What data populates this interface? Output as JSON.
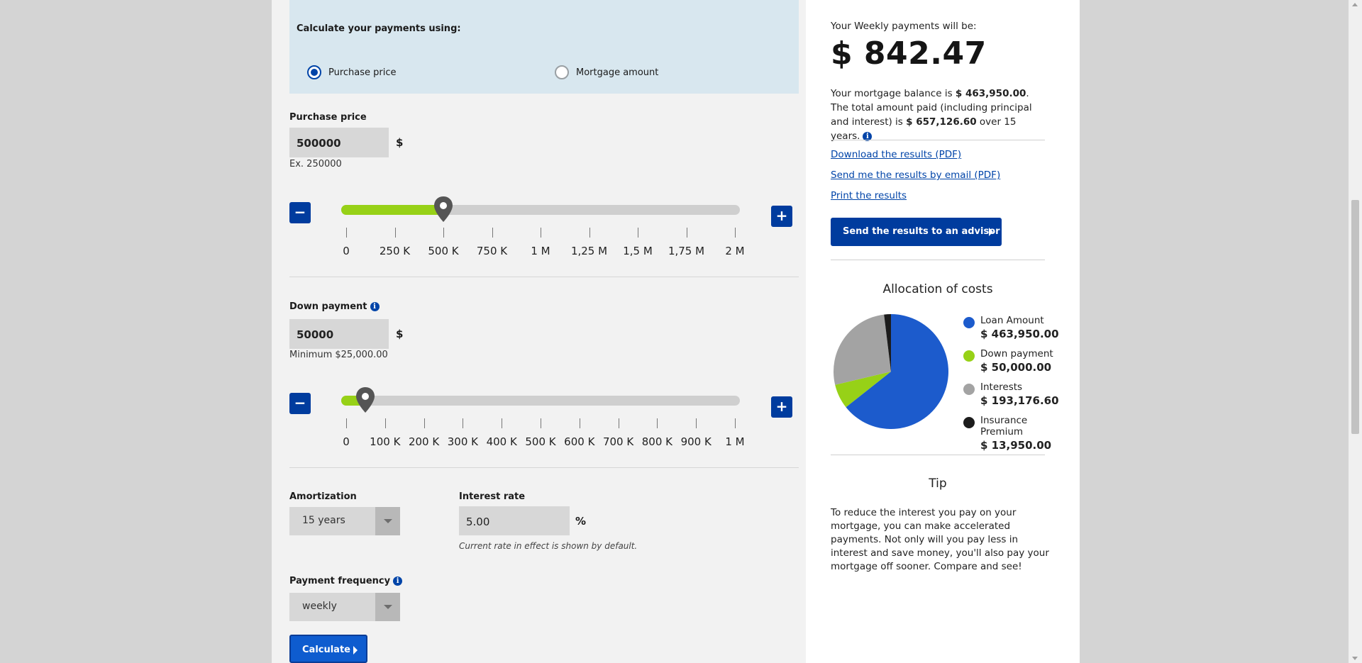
{
  "calculator": {
    "calc_using_label": "Calculate your payments using:",
    "option_purchase": "Purchase price",
    "option_mortgage": "Mortgage amount",
    "purchase": {
      "label": "Purchase price",
      "value": "500000",
      "unit": "$",
      "hint": "Ex. 250000",
      "slider_fraction": 0.25,
      "ticks": [
        "0",
        "250 K",
        "500 K",
        "750 K",
        "1 M",
        "1,25 M",
        "1,5 M",
        "1,75 M",
        "2 M"
      ]
    },
    "down": {
      "label": "Down payment",
      "value": "50000",
      "unit": "$",
      "hint": "Minimum $25,000.00",
      "slider_fraction": 0.05,
      "ticks": [
        "0",
        "100 K",
        "200 K",
        "300 K",
        "400 K",
        "500 K",
        "600 K",
        "700 K",
        "800 K",
        "900 K",
        "1 M"
      ]
    },
    "amortization": {
      "label": "Amortization",
      "value": "15 years"
    },
    "interest": {
      "label": "Interest rate",
      "value": "5.00",
      "unit": "%",
      "note": "Current rate in effect is shown by default."
    },
    "frequency": {
      "label": "Payment frequency",
      "value": "weekly"
    },
    "calculate_label": "Calculate",
    "minus_symbol": "−",
    "plus_symbol": "+",
    "info_symbol": "i"
  },
  "results": {
    "headline": "Your Weekly payments will be:",
    "amount": "$ 842.47",
    "summary_1": "Your mortgage balance is ",
    "balance": "$ 463,950.00",
    "summary_2": ". The total amount paid (including principal and interest) is ",
    "total_paid": "$ 657,126.60",
    "summary_3": " over 15 years.",
    "link_download": "Download the results (PDF)",
    "link_email": "Send me the results by email (PDF)",
    "link_print": "Print the results",
    "advisor_button": "Send the results to an advisor",
    "tip_title": "Tip",
    "tip_text": "To reduce the interest you pay on your mortgage, you can make accelerated payments. Not only will you pay less in interest and save money, you'll also pay your mortgage off sooner. Compare and see!"
  },
  "chart_data": {
    "type": "pie",
    "title": "Allocation of costs",
    "categories": [
      "Loan Amount",
      "Down payment",
      "Interests",
      "Insurance Premium"
    ],
    "values": [
      463950.0,
      50000.0,
      193176.6,
      13950.0
    ],
    "value_labels": [
      "$ 463,950.00",
      "$ 50,000.00",
      "$ 193,176.60",
      "$ 13,950.00"
    ],
    "colors": [
      "#1c5bcc",
      "#97d117",
      "#a3a3a3",
      "#1c1c1c"
    ],
    "legend": "right"
  }
}
